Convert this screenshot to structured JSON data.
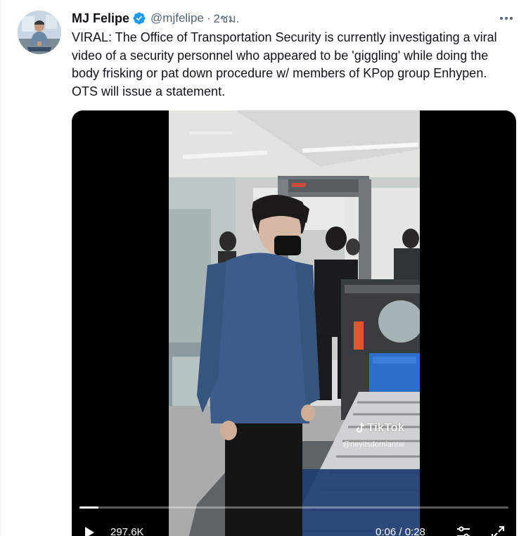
{
  "tweet": {
    "display_name": "MJ Felipe",
    "handle": "@mjfelipe",
    "separator": "·",
    "time": "2ชม.",
    "text": "VIRAL: The Office of Transportation Security is currently investigating a viral video of a security personnel who appeared to be 'giggling' while doing the body frisking or pat down procedure w/ members of KPop group Enhypen. OTS will issue a statement.",
    "verified_icon": "verified-badge-icon",
    "more_icon": "more-options-icon"
  },
  "media": {
    "watermark": {
      "brand": "TikTok",
      "username": "@neyitsdomianne"
    },
    "player": {
      "progress": 0.045,
      "views": "297.6K",
      "timecode": "0:06 / 0:28",
      "play_icon": "play-icon",
      "settings_icon": "settings-icon",
      "fullscreen_icon": "fullscreen-icon"
    }
  },
  "colors": {
    "text_primary": "#0f1419",
    "text_secondary": "#536471",
    "verified_blue": "#1d9bf0",
    "video_background": "#000000"
  }
}
